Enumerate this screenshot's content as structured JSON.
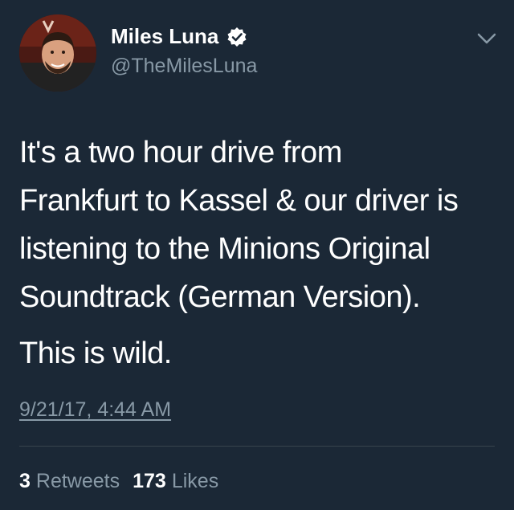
{
  "user": {
    "display_name": "Miles Luna",
    "handle": "@TheMilesLuna",
    "verified": true,
    "avatar_icon": "profile-photo"
  },
  "tweet": {
    "lines": [
      "It's a two hour drive from",
      "Frankfurt to Kassel & our driver is",
      "listening to the Minions Original",
      "Soundtrack (German Version)."
    ],
    "second_paragraph": "This is wild.",
    "timestamp": "9/21/17, 4:44 AM"
  },
  "stats": {
    "retweets_count": "3",
    "retweets_label": "Retweets",
    "likes_count": "173",
    "likes_label": "Likes"
  },
  "colors": {
    "background": "#1b2836",
    "text_primary": "#ffffff",
    "text_secondary": "#8899a6",
    "divider": "#38444d"
  }
}
